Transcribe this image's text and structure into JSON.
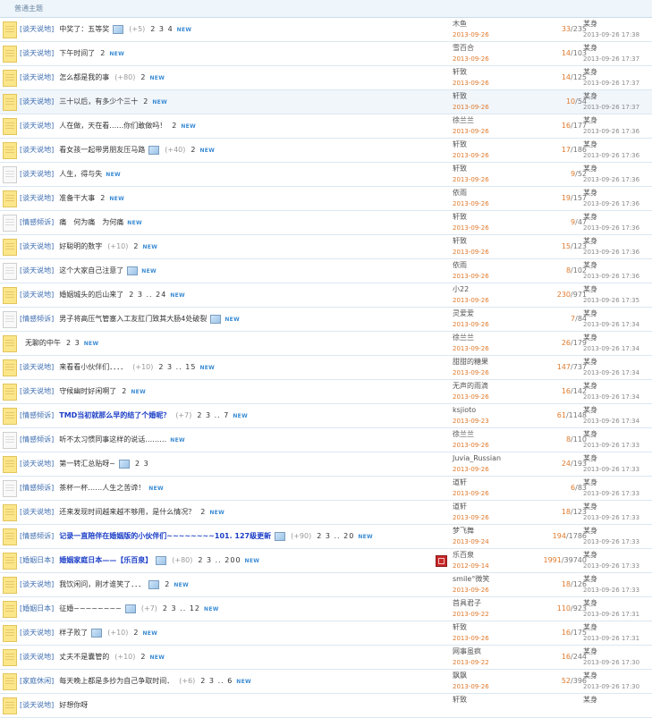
{
  "header": {
    "title": "普通主题"
  },
  "rows": [
    {
      "icon": "yellow",
      "cat": "[谈天说地]",
      "title": "中奖了：五等奖",
      "hl": false,
      "img": true,
      "cnt": "(+5)",
      "pages": "2 3 4",
      "new": true,
      "author": "木鱼",
      "date": "2013-09-26",
      "replies": "33",
      "views": "/235",
      "last": "某身",
      "ltime": "2013-09-26 17:38"
    },
    {
      "icon": "yellow",
      "cat": "[谈天说地]",
      "title": "下午时间了",
      "hl": false,
      "img": false,
      "cnt": "",
      "pages": "2",
      "new": true,
      "author": "雪百合",
      "date": "2013-09-26",
      "replies": "14",
      "views": "/103",
      "last": "某身",
      "ltime": "2013-09-26 17:37"
    },
    {
      "icon": "yellow",
      "cat": "[谈天说地]",
      "title": "怎么都是我的事",
      "hl": false,
      "img": false,
      "cnt": "(+80)",
      "pages": "2",
      "new": true,
      "author": "轩致",
      "date": "2013-09-26",
      "replies": "14",
      "views": "/125",
      "last": "某身",
      "ltime": "2013-09-26 17:37"
    },
    {
      "icon": "yellow",
      "cat": "[谈天说地]",
      "title": "三十以后，有多少个三十",
      "hl": false,
      "img": false,
      "cnt": "",
      "pages": "2",
      "new": true,
      "author": "轩致",
      "date": "2013-09-26",
      "replies": "10",
      "views": "/54",
      "last": "某身",
      "ltime": "2013-09-26 17:37"
    },
    {
      "icon": "yellow",
      "cat": "[谈天说地]",
      "title": "人在做，天在看……你们敢做吗！",
      "hl": false,
      "img": false,
      "cnt": "",
      "pages": "2",
      "new": true,
      "author": "徐兰兰",
      "date": "2013-09-26",
      "replies": "16",
      "views": "/177",
      "last": "某身",
      "ltime": "2013-09-26 17:36"
    },
    {
      "icon": "yellow",
      "cat": "[谈天说地]",
      "title": "看女孩一起带男朋友压马路",
      "hl": false,
      "img": true,
      "cnt": "(+40)",
      "pages": "2",
      "new": true,
      "author": "轩致",
      "date": "2013-09-26",
      "replies": "17",
      "views": "/186",
      "last": "某身",
      "ltime": "2013-09-26 17:36"
    },
    {
      "icon": "white",
      "cat": "[谈天说地]",
      "title": "人生，得与失",
      "hl": false,
      "img": false,
      "cnt": "",
      "pages": "",
      "new": true,
      "author": "轩致",
      "date": "2013-09-26",
      "replies": "9",
      "views": "/52",
      "last": "某身",
      "ltime": "2013-09-26 17:36"
    },
    {
      "icon": "yellow",
      "cat": "[谈天说地]",
      "title": "准备干大事",
      "hl": false,
      "img": false,
      "cnt": "",
      "pages": "2",
      "new": true,
      "author": "依雨",
      "date": "2013-09-26",
      "replies": "19",
      "views": "/157",
      "last": "某身",
      "ltime": "2013-09-26 17:36"
    },
    {
      "icon": "white",
      "cat": "[情感倾诉]",
      "title": "痛　何为痛　为何痛",
      "hl": false,
      "img": false,
      "cnt": "",
      "pages": "",
      "new": true,
      "author": "轩致",
      "date": "2013-09-26",
      "replies": "9",
      "views": "/47",
      "last": "某身",
      "ltime": "2013-09-26 17:36"
    },
    {
      "icon": "yellow",
      "cat": "[谈天说地]",
      "title": "好聪明的数字",
      "hl": false,
      "img": false,
      "cnt": "(+10)",
      "pages": "2",
      "new": true,
      "author": "轩致",
      "date": "2013-09-26",
      "replies": "15",
      "views": "/123",
      "last": "某身",
      "ltime": "2013-09-26 17:36"
    },
    {
      "icon": "white",
      "cat": "[谈天说地]",
      "title": "这个大家自己注意了",
      "hl": false,
      "img": true,
      "cnt": "",
      "pages": "",
      "new": true,
      "author": "依雨",
      "date": "2013-09-26",
      "replies": "8",
      "views": "/102",
      "last": "某身",
      "ltime": "2013-09-26 17:36"
    },
    {
      "icon": "yellow",
      "cat": "[谈天说地]",
      "title": "婚姻城头的后山来了",
      "hl": false,
      "img": false,
      "cnt": "",
      "pages": "2 3 .. 24",
      "new": true,
      "author": "小22",
      "date": "2013-09-26",
      "replies": "230",
      "views": "/971",
      "last": "某身",
      "ltime": "2013-09-26 17:35"
    },
    {
      "icon": "white",
      "cat": "[情感倾诉]",
      "title": "男子将高压气管塞入工友肛门致其大肠4处破裂",
      "hl": false,
      "img": true,
      "cnt": "",
      "pages": "",
      "new": true,
      "author": "灵爱爱",
      "date": "2013-09-26",
      "replies": "7",
      "views": "/84",
      "last": "某身",
      "ltime": "2013-09-26 17:34"
    },
    {
      "icon": "yellow",
      "cat": "",
      "title": "无聊的中午",
      "hl": false,
      "img": false,
      "cnt": "",
      "pages": "2 3",
      "new": true,
      "author": "徐兰兰",
      "date": "2013-09-26",
      "replies": "26",
      "views": "/179",
      "last": "某身",
      "ltime": "2013-09-26 17:34"
    },
    {
      "icon": "yellow",
      "cat": "[谈天说地]",
      "title": "来看看小伙伴们．．．．",
      "hl": false,
      "img": false,
      "cnt": "(+10)",
      "pages": "2 3 .. 15",
      "new": true,
      "author": "甜甜的糖果",
      "date": "2013-09-26",
      "replies": "147",
      "views": "/737",
      "last": "某身",
      "ltime": "2013-09-26 17:34"
    },
    {
      "icon": "yellow",
      "cat": "[谈天说地]",
      "title": "守候幽时好闲啊了",
      "hl": false,
      "img": false,
      "cnt": "",
      "pages": "2",
      "new": true,
      "author": "无声的雨滴",
      "date": "2013-09-26",
      "replies": "16",
      "views": "/142",
      "last": "某身",
      "ltime": "2013-09-26 17:34"
    },
    {
      "icon": "yellow",
      "cat": "[情感倾诉]",
      "title": "TMD当初就那么早的结了个婚呢？",
      "hl": true,
      "img": false,
      "cnt": "(+7)",
      "pages": "2 3 .. 7",
      "new": true,
      "author": "ksjioto",
      "date": "2013-09-23",
      "replies": "61",
      "views": "/1148",
      "last": "某身",
      "ltime": "2013-09-26 17:34"
    },
    {
      "icon": "white",
      "cat": "[情感倾诉]",
      "title": "听不太习惯同事这样的说话………",
      "hl": false,
      "img": false,
      "cnt": "",
      "pages": "",
      "new": true,
      "author": "徐兰兰",
      "date": "2013-09-26",
      "replies": "8",
      "views": "/110",
      "last": "某身",
      "ltime": "2013-09-26 17:33"
    },
    {
      "icon": "yellow",
      "cat": "[谈天说地]",
      "title": "第一转汇总贴呀~",
      "hl": false,
      "img": true,
      "cnt": "",
      "pages": "2 3",
      "new": false,
      "author": "Juvia_Russian",
      "date": "2013-09-26",
      "replies": "24",
      "views": "/193",
      "last": "某身",
      "ltime": "2013-09-26 17:33"
    },
    {
      "icon": "white",
      "cat": "[情感倾诉]",
      "title": "茶杯一杯……人生之苦谛！",
      "hl": false,
      "img": false,
      "cnt": "",
      "pages": "",
      "new": true,
      "author": "道轩",
      "date": "2013-09-26",
      "replies": "6",
      "views": "/83",
      "last": "某身",
      "ltime": "2013-09-26 17:33"
    },
    {
      "icon": "yellow",
      "cat": "[谈天说地]",
      "title": "还来发现时间越来越不够用，是什么情况？",
      "hl": false,
      "img": false,
      "cnt": "",
      "pages": "2",
      "new": true,
      "author": "道轩",
      "date": "2013-09-26",
      "replies": "18",
      "views": "/123",
      "last": "某身",
      "ltime": "2013-09-26 17:33"
    },
    {
      "icon": "yellow",
      "cat": "[情感倾诉]",
      "title": "记录一直陪伴在婚姻版的小伙伴们~~~~~~~~101. 127级更新",
      "hl": true,
      "img": true,
      "cnt": "(+90)",
      "pages": "2 3 .. 20",
      "new": true,
      "author": "梦飞舞",
      "date": "2013-09-24",
      "replies": "194",
      "views": "/1786",
      "last": "某身",
      "ltime": "2013-09-26 17:33"
    },
    {
      "icon": "yellow",
      "cat": "[婚姻日本]",
      "title": "婚姻家庭日本——【乐百泉】",
      "hl": true,
      "img": true,
      "cnt": "(+80)",
      "pages": "2 3 .. 200",
      "new": true,
      "author": "乐百泉",
      "date": "2012-09-14",
      "replies": "1991",
      "views": "/39740",
      "last": "某身",
      "ltime": "2013-09-26 17:33",
      "seal": true
    },
    {
      "icon": "yellow",
      "cat": "[谈天说地]",
      "title": "我饮闲问，刚才谁笑了．．．",
      "hl": false,
      "img": true,
      "cnt": "",
      "pages": "2",
      "new": true,
      "author": "smile°微笑",
      "date": "2013-09-26",
      "replies": "18",
      "views": "/126",
      "last": "某身",
      "ltime": "2013-09-26 17:33"
    },
    {
      "icon": "yellow",
      "cat": "[婚姻日本]",
      "title": "征婚~~~~~~~~",
      "hl": false,
      "img": true,
      "cnt": "(+7)",
      "pages": "2 3 .. 12",
      "new": true,
      "author": "首具君子",
      "date": "2013-09-22",
      "replies": "110",
      "views": "/923",
      "last": "某身",
      "ltime": "2013-09-26 17:31"
    },
    {
      "icon": "yellow",
      "cat": "[谈天说地]",
      "title": "样子败了",
      "hl": false,
      "img": true,
      "cnt": "(+10)",
      "pages": "2",
      "new": true,
      "author": "轩致",
      "date": "2013-09-26",
      "replies": "16",
      "views": "/175",
      "last": "某身",
      "ltime": "2013-09-26 17:31"
    },
    {
      "icon": "yellow",
      "cat": "[谈天说地]",
      "title": "丈夫不是囊管的",
      "hl": false,
      "img": false,
      "cnt": "(+10)",
      "pages": "2",
      "new": true,
      "author": "网事虽疯",
      "date": "2013-09-22",
      "replies": "16",
      "views": "/244",
      "last": "某身",
      "ltime": "2013-09-26 17:30"
    },
    {
      "icon": "yellow",
      "cat": "[家庭休闲]",
      "title": "每天晚上都是多抄为自己争取时间．",
      "hl": false,
      "img": false,
      "cnt": "(+6)",
      "pages": "2 3 .. 6",
      "new": true,
      "author": "飘飘",
      "date": "2013-09-26",
      "replies": "52",
      "views": "/396",
      "last": "某身",
      "ltime": "2013-09-26 17:30"
    },
    {
      "icon": "yellow",
      "cat": "[谈天说地]",
      "title": "好想你呀",
      "hl": false,
      "img": false,
      "cnt": "",
      "pages": "",
      "new": false,
      "author": "轩致",
      "date": "",
      "replies": "",
      "views": "",
      "last": "某身",
      "ltime": ""
    }
  ]
}
